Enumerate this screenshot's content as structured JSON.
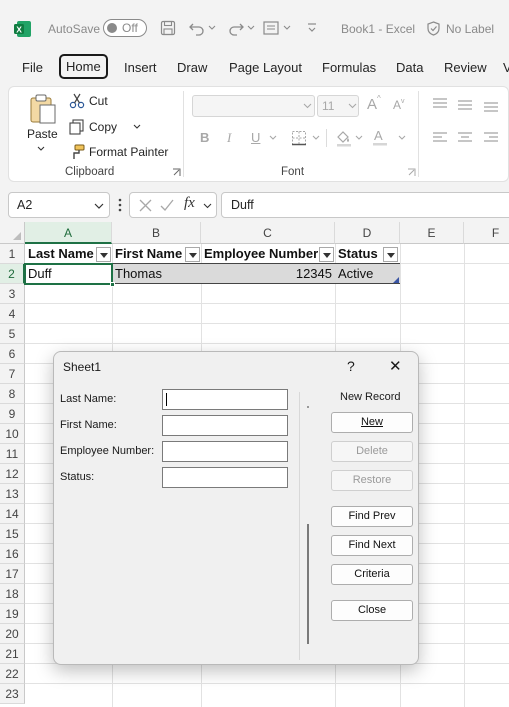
{
  "titlebar": {
    "autosave_label": "AutoSave",
    "autosave_state": "Off",
    "doc_title": "Book1 - Excel",
    "sensitivity": "No Label"
  },
  "menu": {
    "tabs": [
      "File",
      "Home",
      "Insert",
      "Draw",
      "Page Layout",
      "Formulas",
      "Data",
      "Review",
      "V"
    ],
    "active": "Home"
  },
  "ribbon": {
    "clipboard": {
      "paste": "Paste",
      "cut": "Cut",
      "copy": "Copy",
      "format_painter": "Format Painter",
      "group_label": "Clipboard"
    },
    "font": {
      "size": "11",
      "bold": "B",
      "italic": "I",
      "underline": "U",
      "grow": "A",
      "shrink": "A",
      "group_label": "Font"
    }
  },
  "formula_bar": {
    "name_box": "A2",
    "fx": "fx",
    "value": "Duff"
  },
  "grid": {
    "columns": [
      "A",
      "B",
      "C",
      "D",
      "E",
      "F"
    ],
    "rows": [
      "1",
      "2",
      "3",
      "4",
      "5",
      "6",
      "7",
      "8",
      "9",
      "10",
      "11",
      "12",
      "13",
      "14",
      "15",
      "16",
      "17",
      "18",
      "19",
      "20",
      "21",
      "22",
      "23"
    ],
    "headers": [
      "Last Name",
      "First Name",
      "Employee Number",
      "Status"
    ],
    "row2": [
      "Duff",
      "Thomas",
      "12345",
      "Active"
    ],
    "active_cell": "A2"
  },
  "dialog": {
    "title": "Sheet1",
    "help": "?",
    "close_x": "✕",
    "fields": [
      {
        "label": "Last Name:",
        "value": ""
      },
      {
        "label": "First Name:",
        "value": ""
      },
      {
        "label": "Employee Number:",
        "value": ""
      },
      {
        "label": "Status:",
        "value": ""
      }
    ],
    "record_status": "New Record",
    "buttons": {
      "new": "New",
      "delete": "Delete",
      "restore": "Restore",
      "find_prev": "Find Prev",
      "find_next": "Find Next",
      "criteria": "Criteria",
      "close": "Close"
    }
  },
  "colors": {
    "excel_green": "#1e7145",
    "selection_fill": "#e1efe5"
  }
}
